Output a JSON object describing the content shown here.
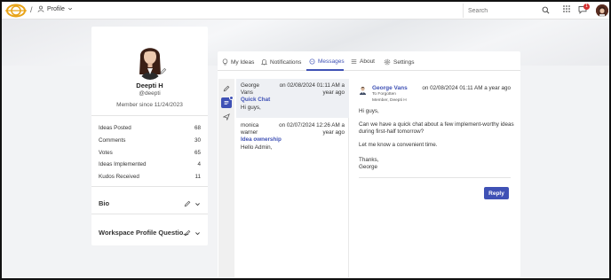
{
  "header": {
    "breadcrumb_separator": "/",
    "profile_label": "Profile",
    "search_placeholder": "Search",
    "notification_count": "1"
  },
  "profile": {
    "name": "Deepti H",
    "handle": "@deepti",
    "member_since": "Member since 11/24/2023",
    "stats": [
      {
        "label": "Ideas Posted",
        "value": "68"
      },
      {
        "label": "Comments",
        "value": "30"
      },
      {
        "label": "Votes",
        "value": "65"
      },
      {
        "label": "Ideas Implemented",
        "value": "4"
      },
      {
        "label": "Kudos Received",
        "value": "11"
      }
    ],
    "sections": [
      {
        "title": "Bio"
      },
      {
        "title": "Workspace Profile Questio..."
      }
    ]
  },
  "tabs": [
    {
      "label": "My Ideas",
      "icon": "bulb-icon"
    },
    {
      "label": "Notifications",
      "icon": "bell-icon"
    },
    {
      "label": "Messages",
      "icon": "chat-icon",
      "active": true
    },
    {
      "label": "About",
      "icon": "list-icon"
    },
    {
      "label": "Settings",
      "icon": "gear-icon"
    }
  ],
  "conversations": [
    {
      "from": "George Vans",
      "date": "on 02/08/2024 01:11 AM a year ago",
      "subject": "Quick Chat",
      "preview": "Hi guys,",
      "selected": true
    },
    {
      "from": "monica warner",
      "date": "on 02/07/2024 12:26 AM a year ago",
      "subject": "Idea ownership",
      "preview": "Hello Admin,",
      "selected": false
    }
  ],
  "message": {
    "sender": "George Vans",
    "date": "on 02/08/2024 01:11 AM a year ago",
    "to": "To Forgotten",
    "member_line": "Member, Deepti H",
    "lines": [
      "Hi guys,",
      "Can we have a quick chat about a few implement-worthy ideas during first-half tomorrow?",
      "Let me know a convenient time.",
      "Thanks,",
      "George"
    ],
    "reply_label": "Reply"
  },
  "colors": {
    "accent": "#3f51b5",
    "badge": "#d32f2f"
  }
}
